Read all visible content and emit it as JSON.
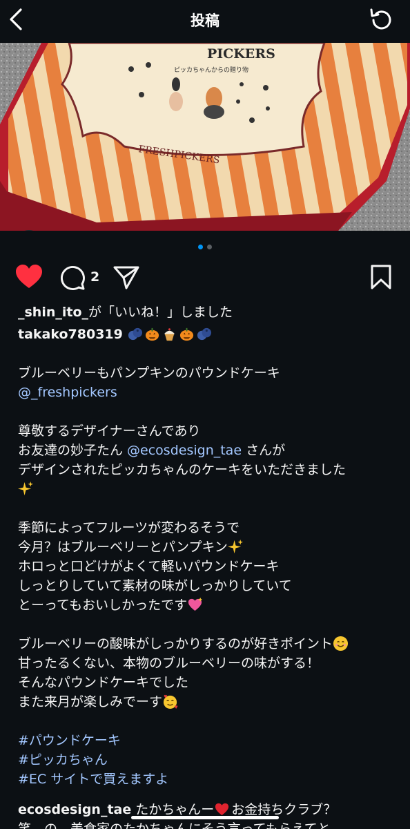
{
  "header": {
    "title": "投稿",
    "back_icon": "chevron-left-icon",
    "refresh_icon": "refresh-icon"
  },
  "photo": {
    "description_icon": "user-tag-icon",
    "box_brand_text": "PICKERS",
    "box_brand_subtext": "ピッカちゃんからの贈り物",
    "box_side_text": "FRESHPICKERS"
  },
  "carousel": {
    "page": 1,
    "total": 2
  },
  "actions": {
    "liked": true,
    "comment_count": "2",
    "like_color": "#ff3040"
  },
  "likes": {
    "user": "_shin_ito_",
    "suffix": "が「いいね！」しました"
  },
  "caption": {
    "author": "takako780319",
    "author_emojis": [
      "blueberry",
      "jack-o-lantern",
      "cupcake",
      "jack-o-lantern",
      "blueberry"
    ],
    "lines": {
      "l1": "ブルーベリーもパンプキンのパウンドケーキ",
      "l2_mention": "@_freshpickers",
      "l3": "尊敬するデザイナーさんであり",
      "l4_pre": "お友達の妙子たん ",
      "l4_mention": "@ecosdesign_tae",
      "l4_post": " さんが",
      "l5": "デザインされたピッカちゃんのケーキをいただきました",
      "l6_emoji": "sparkles",
      "l7": "季節によってフルーツが変わるそうで",
      "l8": "今月？はブルーベリーとパンプキン",
      "l9": "ホロっと口どけがよくて軽いパウンドケーキ",
      "l10": "しっとりしていて素材の味がしっかりしていて",
      "l11": "とーってもおいしかったです",
      "l12": "ブルーベリーの酸味がしっかりするのが好きポイント",
      "l13": "甘ったるくない、本物のブルーベリーの味がする！",
      "l14": "そんなパウンドケーキでした",
      "l15": "また来月が楽しみでーす"
    },
    "hashtags": [
      "#パウンドケーキ",
      "#ピッカちゃん",
      "#EC サイトで買えますよ"
    ]
  },
  "comment": {
    "author": "ecosdesign_tae",
    "text": " たかちゃんー",
    "text_after_heart": "お金持ちクラブ？",
    "line2": "笑　の　美食家のたかちゃんにそう言ってもらえてと"
  },
  "colors": {
    "background": "#0c1014",
    "link": "#a3c7ff",
    "dot_active": "#0095f6"
  }
}
